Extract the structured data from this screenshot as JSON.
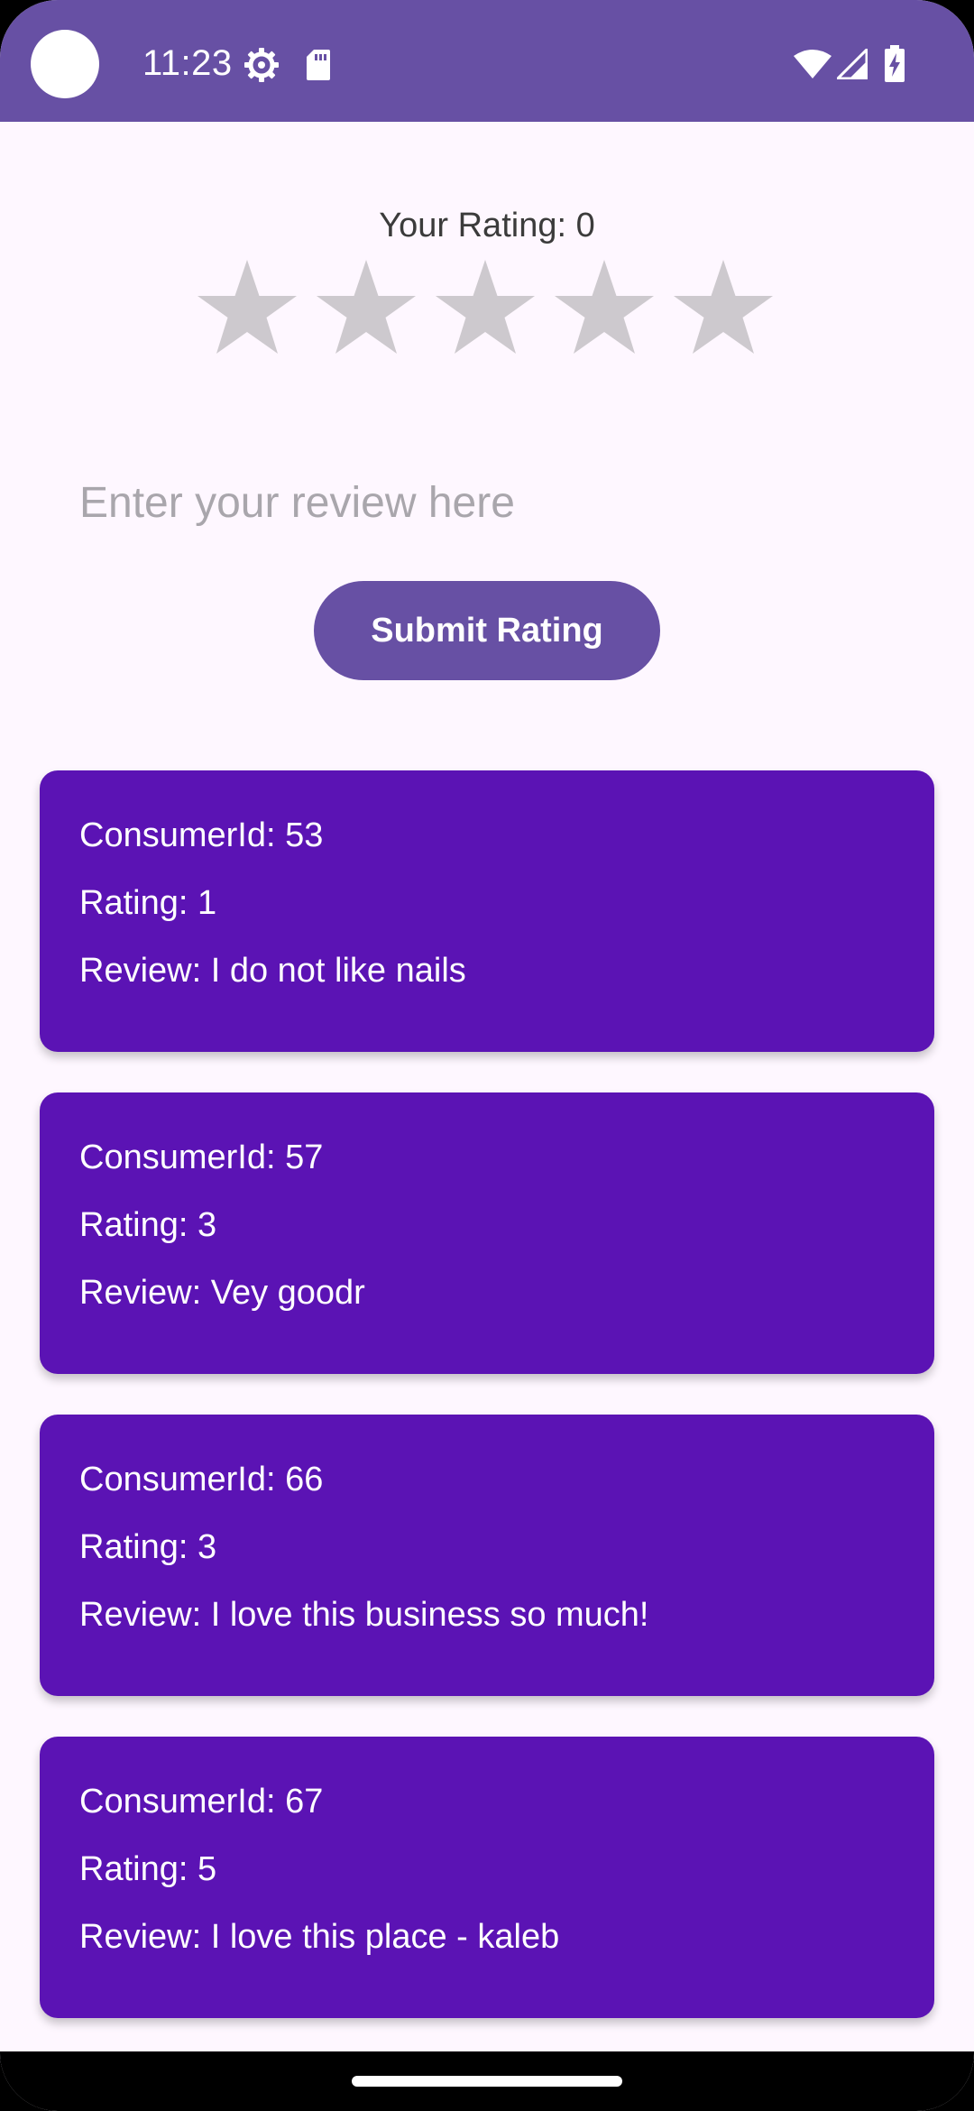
{
  "status_bar": {
    "time": "11:23",
    "icons": [
      "gear-icon",
      "sd-card-icon",
      "wifi-icon",
      "cell-signal-icon",
      "battery-charging-icon"
    ],
    "background": "#6750A4"
  },
  "rating": {
    "label": "Your Rating: 0",
    "value": 0,
    "max": 5,
    "star_color_inactive": "#CDC9CE"
  },
  "review_input": {
    "value": "",
    "placeholder": "Enter your review here"
  },
  "submit_button": {
    "label": "Submit Rating",
    "color": "#6750A4"
  },
  "reviews": [
    {
      "consumer": "ConsumerId: 53",
      "rating": "Rating: 1",
      "review": "Review: I do not like nails"
    },
    {
      "consumer": "ConsumerId: 57",
      "rating": "Rating: 3",
      "review": "Review: Vey goodr"
    },
    {
      "consumer": "ConsumerId: 66",
      "rating": "Rating: 3",
      "review": "Review: I love this business so much!"
    },
    {
      "consumer": "ConsumerId: 67",
      "rating": "Rating: 5",
      "review": "Review: I love this place - kaleb"
    }
  ],
  "card_color": "#5B13B4"
}
